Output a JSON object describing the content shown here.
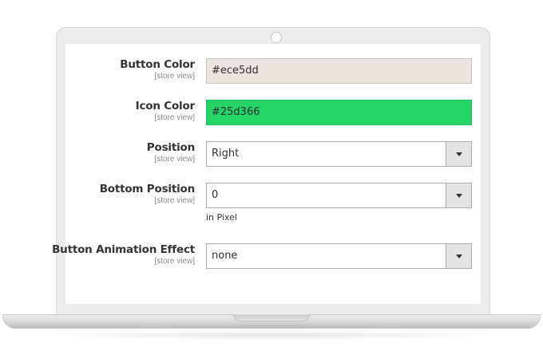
{
  "form": {
    "button_color": {
      "label": "Button Color",
      "scope": "[store view]",
      "value": "#ece5dd",
      "color": "#ece5dd"
    },
    "icon_color": {
      "label": "Icon Color",
      "scope": "[store view]",
      "value": "#25d366",
      "color": "#25d366"
    },
    "position": {
      "label": "Position",
      "scope": "[store view]",
      "value": "Right"
    },
    "bottom_position": {
      "label": "Bottom Position",
      "scope": "[store view]",
      "value": "0",
      "note": "in Pixel"
    },
    "animation": {
      "label": "Button Animation Effect",
      "scope": "[store view]",
      "value": "none"
    }
  },
  "icons": {
    "dropdown": "chevron-down-icon",
    "camera": "camera-icon"
  }
}
